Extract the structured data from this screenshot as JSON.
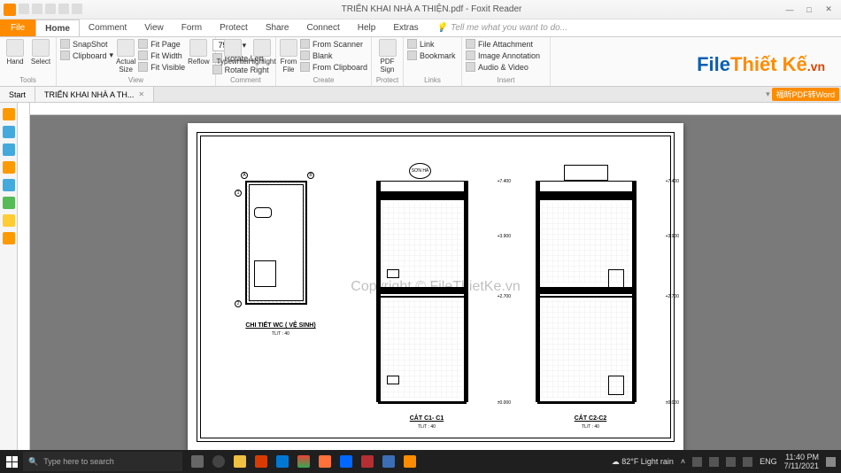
{
  "title": "TRIỂN KHAI NHÀ A THIỆN.pdf - Foxit Reader",
  "menutabs": {
    "file": "File",
    "home": "Home",
    "comment": "Comment",
    "view": "View",
    "form": "Form",
    "protect": "Protect",
    "share": "Share",
    "connect": "Connect",
    "help": "Help",
    "extras": "Extras",
    "tell": "Tell me what you want to do..."
  },
  "ribbon": {
    "tools": {
      "hand": "Hand",
      "select": "Select",
      "label": "Tools"
    },
    "clipboard": {
      "snapshot": "SnapShot",
      "clip": "Clipboard",
      "actual": "Actual\nSize",
      "fitpage": "Fit Page",
      "fitwidth": "Fit Width",
      "fitvisible": "Fit Visible",
      "reflow": "Reflow",
      "zoom": "75%",
      "rotl": "Rotate Left",
      "rotr": "Rotate Right",
      "label": "View"
    },
    "typewriter": {
      "tw": "Typewriter",
      "hl": "Highlight",
      "label": "Comment"
    },
    "create": {
      "fromfile": "From\nFile",
      "fromscanner": "From Scanner",
      "blank": "Blank",
      "fromclip": "From Clipboard",
      "label": "Create"
    },
    "protect": {
      "pdfsign": "PDF\nSign",
      "label": "Protect"
    },
    "links": {
      "link": "Link",
      "bookmark": "Bookmark",
      "label": "Links"
    },
    "insert": {
      "fileatt": "File Attachment",
      "imgann": "Image Annotation",
      "av": "Audio & Video",
      "label": "Insert"
    }
  },
  "doctabs": {
    "start": "Start",
    "file": "TRIỂN KHAI NHÀ A TH...",
    "pdf2word": "福昕PDF转Word"
  },
  "drawings": {
    "d1": {
      "title": "CHI TIẾT WC ( VỆ SINH)",
      "scale": "TL/T : 40"
    },
    "d2": {
      "title": "CẮT C1- C1",
      "scale": "TL/T : 40"
    },
    "d3": {
      "title": "CẮT C2-C2",
      "scale": "TL/T : 40"
    },
    "tank": "SƠN HÀ",
    "elev": {
      "e0": "±0.000",
      "e1": "+2.700",
      "e2": "+3.900",
      "e3": "+7.400"
    }
  },
  "wm_logo": {
    "p1": "File",
    "p2": "Thiết Kế",
    "vn": ".vn"
  },
  "wm_center": "Copyright © FileThietKe.vn",
  "status": {
    "zoom": "75%"
  },
  "taskbar": {
    "search": "Type here to search",
    "weather": "82°F  Light rain",
    "lang": "ENG",
    "time": "11:40 PM",
    "date": "7/11/2021"
  }
}
